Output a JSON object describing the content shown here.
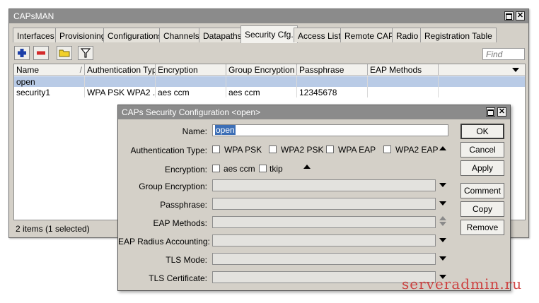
{
  "main_window": {
    "title": "CAPsMAN",
    "tabs": [
      {
        "label": "Interfaces"
      },
      {
        "label": "Provisioning"
      },
      {
        "label": "Configurations"
      },
      {
        "label": "Channels"
      },
      {
        "label": "Datapaths"
      },
      {
        "label": "Security Cfg.",
        "active": true
      },
      {
        "label": "Access List"
      },
      {
        "label": "Remote CAP"
      },
      {
        "label": "Radio"
      },
      {
        "label": "Registration Table"
      }
    ],
    "search_placeholder": "Find",
    "table": {
      "columns": [
        "Name",
        "Authentication Type",
        "Encryption",
        "Group Encryption",
        "Passphrase",
        "EAP Methods"
      ],
      "rows": [
        {
          "cells": [
            "open",
            "",
            "",
            "",
            "",
            ""
          ],
          "selected": true
        },
        {
          "cells": [
            "security1",
            "WPA PSK WPA2 ...",
            "aes ccm",
            "aes ccm",
            "12345678",
            ""
          ],
          "selected": false
        }
      ]
    },
    "status": "2 items (1 selected)"
  },
  "dialog": {
    "title": "CAPs Security Configuration <open>",
    "fields": {
      "name": {
        "label": "Name:",
        "value": "open"
      },
      "authentication_type": {
        "label": "Authentication Type:",
        "options": [
          {
            "label": "WPA PSK",
            "checked": false
          },
          {
            "label": "WPA2 PSK",
            "checked": false
          },
          {
            "label": "WPA EAP",
            "checked": false
          },
          {
            "label": "WPA2 EAP",
            "checked": false
          }
        ]
      },
      "encryption": {
        "label": "Encryption:",
        "options": [
          {
            "label": "aes ccm",
            "checked": false
          },
          {
            "label": "tkip",
            "checked": false
          }
        ]
      },
      "group_encryption": {
        "label": "Group Encryption:",
        "value": ""
      },
      "passphrase": {
        "label": "Passphrase:",
        "value": ""
      },
      "eap_methods": {
        "label": "EAP Methods:",
        "value": ""
      },
      "eap_radius_accounting": {
        "label": "EAP Radius Accounting:",
        "value": ""
      },
      "tls_mode": {
        "label": "TLS Mode:",
        "value": ""
      },
      "tls_certificate": {
        "label": "TLS Certificate:",
        "value": ""
      }
    },
    "buttons": {
      "ok": "OK",
      "cancel": "Cancel",
      "apply": "Apply",
      "comment": "Comment",
      "copy": "Copy",
      "remove": "Remove"
    }
  },
  "watermark": "serveradmin.ru",
  "colors": {
    "title_bar": "#8b8b8b",
    "window_bg": "#d4d0c8",
    "selected_row": "#b9cbe6",
    "add_icon": "#1c3fa8",
    "remove_icon": "#d42a2a",
    "folder_icon": "#f2d02a",
    "watermark": "#cc2a2a"
  }
}
